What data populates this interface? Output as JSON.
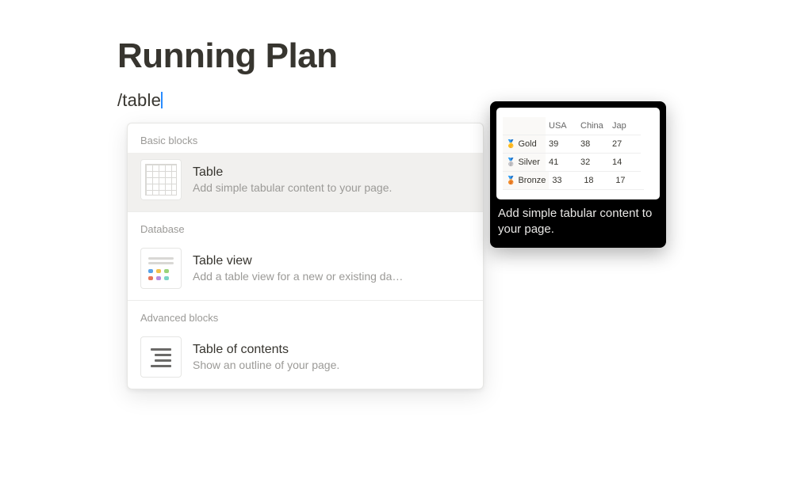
{
  "page": {
    "title": "Running Plan",
    "slash_query": "/table"
  },
  "menu": {
    "sections": [
      {
        "label": "Basic blocks",
        "items": [
          {
            "title": "Table",
            "description": "Add simple tabular content to your page.",
            "icon": "table-grid",
            "selected": true
          }
        ]
      },
      {
        "label": "Database",
        "items": [
          {
            "title": "Table view",
            "description": "Add a table view for a new or existing da…",
            "icon": "table-view",
            "selected": false
          }
        ]
      },
      {
        "label": "Advanced blocks",
        "items": [
          {
            "title": "Table of contents",
            "description": "Show an outline of your page.",
            "icon": "toc",
            "selected": false
          }
        ]
      }
    ]
  },
  "preview": {
    "caption": "Add simple tabular content to your page.",
    "table": {
      "headers": [
        "",
        "USA",
        "China",
        "Jap"
      ],
      "rows": [
        {
          "emoji": "🥇",
          "label": "Gold",
          "cells": [
            "39",
            "38",
            "27"
          ]
        },
        {
          "emoji": "🥈",
          "label": "Silver",
          "cells": [
            "41",
            "32",
            "14"
          ]
        },
        {
          "emoji": "🥉",
          "label": "Bronze",
          "cells": [
            "33",
            "18",
            "17"
          ]
        }
      ]
    }
  }
}
